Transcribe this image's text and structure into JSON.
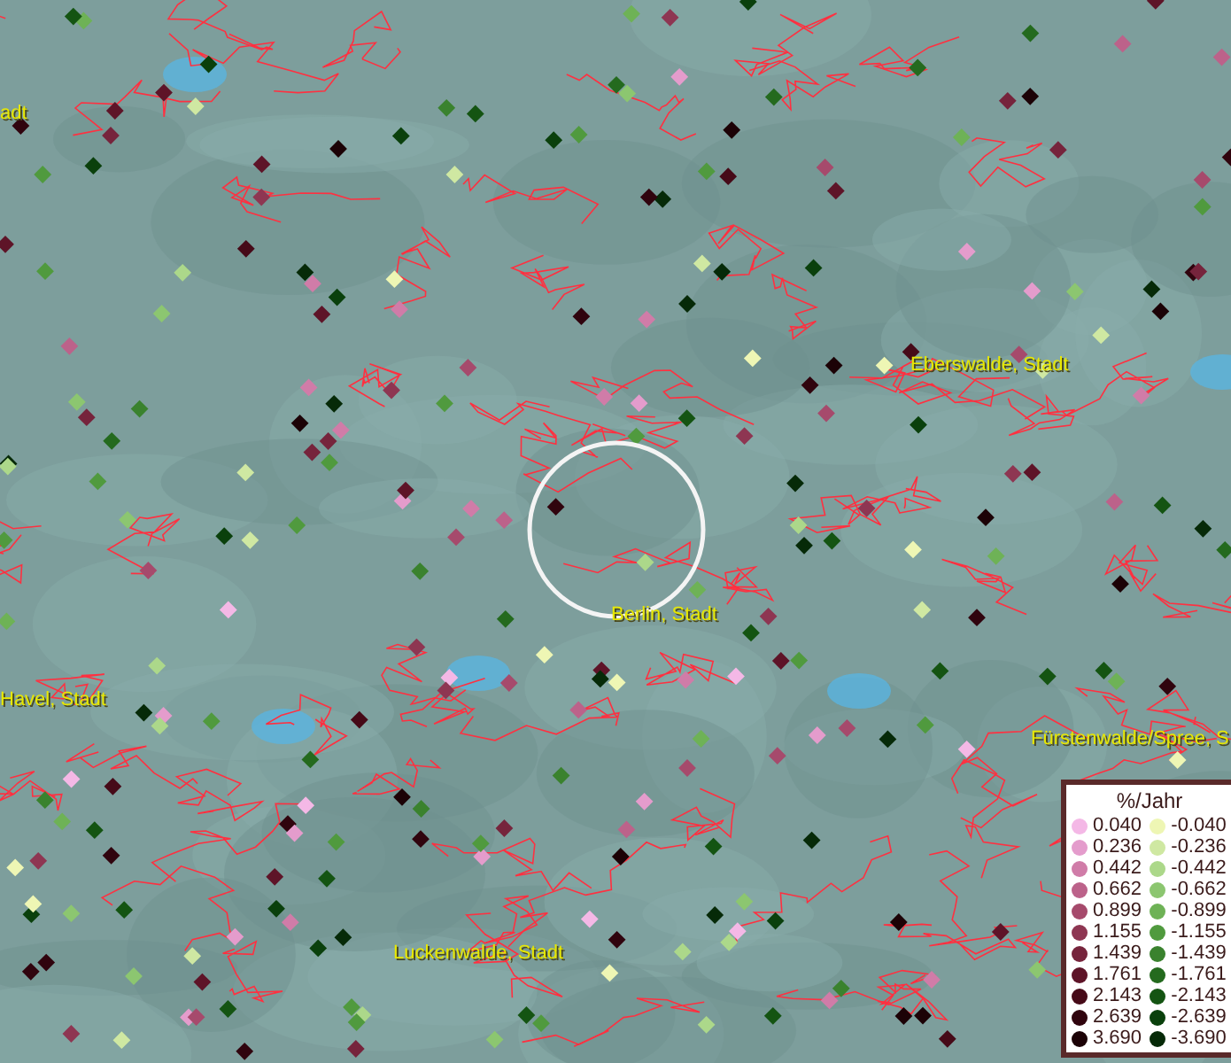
{
  "map": {
    "place_labels": [
      {
        "text": "adt"
      },
      {
        "text": "Eberswalde, Stadt"
      },
      {
        "text": "Berlin, Stadt"
      },
      {
        "text": "Havel, Stadt"
      },
      {
        "text": "Fürstenwalde/Spree, S"
      },
      {
        "text": "Luckenwalde, Stadt"
      }
    ]
  },
  "legend": {
    "title": "%/Jahr",
    "rows": [
      {
        "positive": {
          "label": "0.040",
          "color": "#f4b8e6"
        },
        "negative": {
          "label": "-0.040",
          "color": "#eef6b4"
        }
      },
      {
        "positive": {
          "label": "0.236",
          "color": "#e49ccc"
        },
        "negative": {
          "label": "-0.236",
          "color": "#cfe8a2"
        }
      },
      {
        "positive": {
          "label": "0.442",
          "color": "#d07ca8"
        },
        "negative": {
          "label": "-0.442",
          "color": "#acd88a"
        }
      },
      {
        "positive": {
          "label": "0.662",
          "color": "#bc628a"
        },
        "negative": {
          "label": "-0.662",
          "color": "#8cc670"
        }
      },
      {
        "positive": {
          "label": "0.899",
          "color": "#a64a6c"
        },
        "negative": {
          "label": "-0.899",
          "color": "#6eb256"
        }
      },
      {
        "positive": {
          "label": "1.155",
          "color": "#8e3652"
        },
        "negative": {
          "label": "-1.155",
          "color": "#509a3e"
        }
      },
      {
        "positive": {
          "label": "1.439",
          "color": "#76243c"
        },
        "negative": {
          "label": "-1.439",
          "color": "#3a822e"
        }
      },
      {
        "positive": {
          "label": "1.761",
          "color": "#5e1428"
        },
        "negative": {
          "label": "-1.761",
          "color": "#246a1e"
        }
      },
      {
        "positive": {
          "label": "2.143",
          "color": "#460a18"
        },
        "negative": {
          "label": "-2.143",
          "color": "#145412"
        }
      },
      {
        "positive": {
          "label": "2.639",
          "color": "#30040e"
        },
        "negative": {
          "label": "-2.639",
          "color": "#0a400c"
        }
      },
      {
        "positive": {
          "label": "3.690",
          "color": "#1c0206"
        },
        "negative": {
          "label": "-3.690",
          "color": "#062a08"
        }
      }
    ]
  }
}
